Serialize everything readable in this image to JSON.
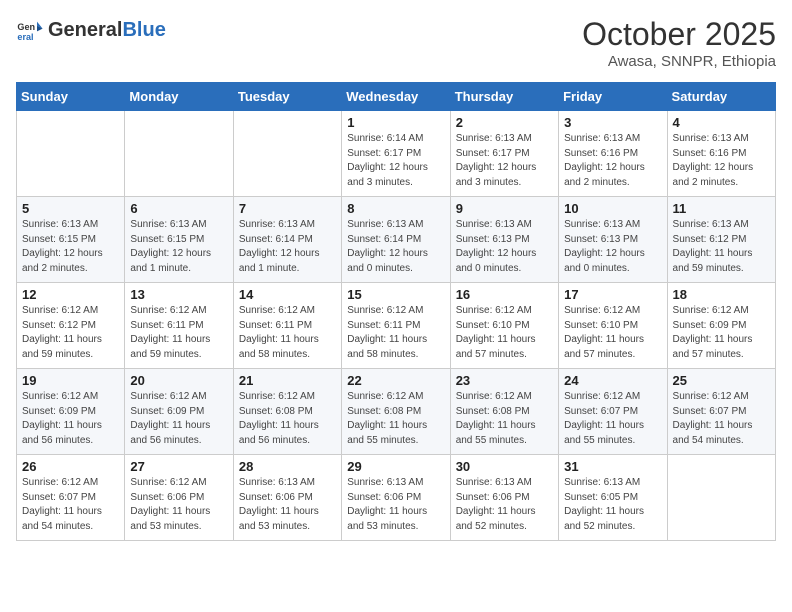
{
  "header": {
    "logo_general": "General",
    "logo_blue": "Blue",
    "month": "October 2025",
    "location": "Awasa, SNNPR, Ethiopia"
  },
  "weekdays": [
    "Sunday",
    "Monday",
    "Tuesday",
    "Wednesday",
    "Thursday",
    "Friday",
    "Saturday"
  ],
  "weeks": [
    [
      {
        "day": "",
        "info": ""
      },
      {
        "day": "",
        "info": ""
      },
      {
        "day": "",
        "info": ""
      },
      {
        "day": "1",
        "info": "Sunrise: 6:14 AM\nSunset: 6:17 PM\nDaylight: 12 hours\nand 3 minutes."
      },
      {
        "day": "2",
        "info": "Sunrise: 6:13 AM\nSunset: 6:17 PM\nDaylight: 12 hours\nand 3 minutes."
      },
      {
        "day": "3",
        "info": "Sunrise: 6:13 AM\nSunset: 6:16 PM\nDaylight: 12 hours\nand 2 minutes."
      },
      {
        "day": "4",
        "info": "Sunrise: 6:13 AM\nSunset: 6:16 PM\nDaylight: 12 hours\nand 2 minutes."
      }
    ],
    [
      {
        "day": "5",
        "info": "Sunrise: 6:13 AM\nSunset: 6:15 PM\nDaylight: 12 hours\nand 2 minutes."
      },
      {
        "day": "6",
        "info": "Sunrise: 6:13 AM\nSunset: 6:15 PM\nDaylight: 12 hours\nand 1 minute."
      },
      {
        "day": "7",
        "info": "Sunrise: 6:13 AM\nSunset: 6:14 PM\nDaylight: 12 hours\nand 1 minute."
      },
      {
        "day": "8",
        "info": "Sunrise: 6:13 AM\nSunset: 6:14 PM\nDaylight: 12 hours\nand 0 minutes."
      },
      {
        "day": "9",
        "info": "Sunrise: 6:13 AM\nSunset: 6:13 PM\nDaylight: 12 hours\nand 0 minutes."
      },
      {
        "day": "10",
        "info": "Sunrise: 6:13 AM\nSunset: 6:13 PM\nDaylight: 12 hours\nand 0 minutes."
      },
      {
        "day": "11",
        "info": "Sunrise: 6:13 AM\nSunset: 6:12 PM\nDaylight: 11 hours\nand 59 minutes."
      }
    ],
    [
      {
        "day": "12",
        "info": "Sunrise: 6:12 AM\nSunset: 6:12 PM\nDaylight: 11 hours\nand 59 minutes."
      },
      {
        "day": "13",
        "info": "Sunrise: 6:12 AM\nSunset: 6:11 PM\nDaylight: 11 hours\nand 59 minutes."
      },
      {
        "day": "14",
        "info": "Sunrise: 6:12 AM\nSunset: 6:11 PM\nDaylight: 11 hours\nand 58 minutes."
      },
      {
        "day": "15",
        "info": "Sunrise: 6:12 AM\nSunset: 6:11 PM\nDaylight: 11 hours\nand 58 minutes."
      },
      {
        "day": "16",
        "info": "Sunrise: 6:12 AM\nSunset: 6:10 PM\nDaylight: 11 hours\nand 57 minutes."
      },
      {
        "day": "17",
        "info": "Sunrise: 6:12 AM\nSunset: 6:10 PM\nDaylight: 11 hours\nand 57 minutes."
      },
      {
        "day": "18",
        "info": "Sunrise: 6:12 AM\nSunset: 6:09 PM\nDaylight: 11 hours\nand 57 minutes."
      }
    ],
    [
      {
        "day": "19",
        "info": "Sunrise: 6:12 AM\nSunset: 6:09 PM\nDaylight: 11 hours\nand 56 minutes."
      },
      {
        "day": "20",
        "info": "Sunrise: 6:12 AM\nSunset: 6:09 PM\nDaylight: 11 hours\nand 56 minutes."
      },
      {
        "day": "21",
        "info": "Sunrise: 6:12 AM\nSunset: 6:08 PM\nDaylight: 11 hours\nand 56 minutes."
      },
      {
        "day": "22",
        "info": "Sunrise: 6:12 AM\nSunset: 6:08 PM\nDaylight: 11 hours\nand 55 minutes."
      },
      {
        "day": "23",
        "info": "Sunrise: 6:12 AM\nSunset: 6:08 PM\nDaylight: 11 hours\nand 55 minutes."
      },
      {
        "day": "24",
        "info": "Sunrise: 6:12 AM\nSunset: 6:07 PM\nDaylight: 11 hours\nand 55 minutes."
      },
      {
        "day": "25",
        "info": "Sunrise: 6:12 AM\nSunset: 6:07 PM\nDaylight: 11 hours\nand 54 minutes."
      }
    ],
    [
      {
        "day": "26",
        "info": "Sunrise: 6:12 AM\nSunset: 6:07 PM\nDaylight: 11 hours\nand 54 minutes."
      },
      {
        "day": "27",
        "info": "Sunrise: 6:12 AM\nSunset: 6:06 PM\nDaylight: 11 hours\nand 53 minutes."
      },
      {
        "day": "28",
        "info": "Sunrise: 6:13 AM\nSunset: 6:06 PM\nDaylight: 11 hours\nand 53 minutes."
      },
      {
        "day": "29",
        "info": "Sunrise: 6:13 AM\nSunset: 6:06 PM\nDaylight: 11 hours\nand 53 minutes."
      },
      {
        "day": "30",
        "info": "Sunrise: 6:13 AM\nSunset: 6:06 PM\nDaylight: 11 hours\nand 52 minutes."
      },
      {
        "day": "31",
        "info": "Sunrise: 6:13 AM\nSunset: 6:05 PM\nDaylight: 11 hours\nand 52 minutes."
      },
      {
        "day": "",
        "info": ""
      }
    ]
  ]
}
